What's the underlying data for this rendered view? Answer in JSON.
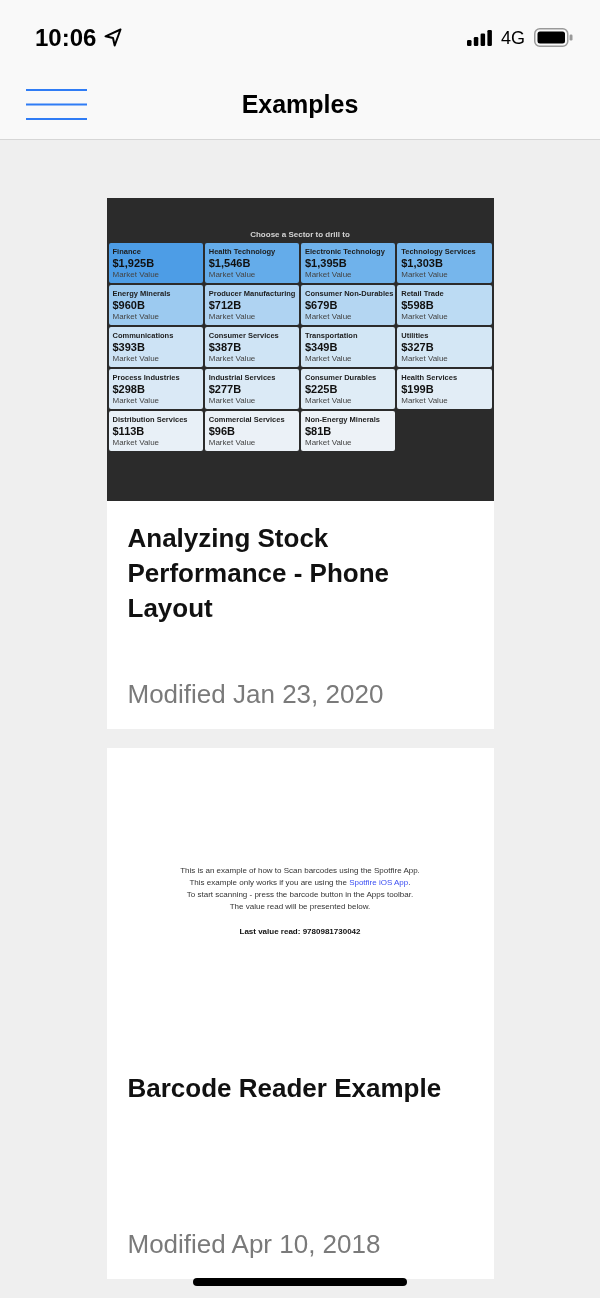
{
  "status_bar": {
    "time": "10:06",
    "network": "4G"
  },
  "nav_bar": {
    "title": "Examples"
  },
  "examples": [
    {
      "kind": "sector_dashboard",
      "preview": {
        "heading": "Choose a Sector to drill to",
        "tiles": [
          {
            "name": "Finance",
            "value": "$1,925B",
            "caption": "Market Value",
            "color": "#4d9de6"
          },
          {
            "name": "Health Technology",
            "value": "$1,546B",
            "caption": "Market Value",
            "color": "#64acea"
          },
          {
            "name": "Electronic Technology",
            "value": "$1,395B",
            "caption": "Market Value",
            "color": "#6fb2eb"
          },
          {
            "name": "Technology Services",
            "value": "$1,303B",
            "caption": "Market Value",
            "color": "#76b6ec"
          },
          {
            "name": "Energy Minerals",
            "value": "$960B",
            "caption": "Market Value",
            "color": "#9ccaf0"
          },
          {
            "name": "Producer Manufacturing",
            "value": "$712B",
            "caption": "Market Value",
            "color": "#afd3f2"
          },
          {
            "name": "Consumer Non-Durables",
            "value": "$679B",
            "caption": "Market Value",
            "color": "#b4d6f2"
          },
          {
            "name": "Retail Trade",
            "value": "$598B",
            "caption": "Market Value",
            "color": "#bcdbf3"
          },
          {
            "name": "Communications",
            "value": "$393B",
            "caption": "Market Value",
            "color": "#cde3f5"
          },
          {
            "name": "Consumer Services",
            "value": "$387B",
            "caption": "Market Value",
            "color": "#cfe4f5"
          },
          {
            "name": "Transportation",
            "value": "$349B",
            "caption": "Market Value",
            "color": "#d2e6f5"
          },
          {
            "name": "Utilities",
            "value": "$327B",
            "caption": "Market Value",
            "color": "#d4e7f5"
          },
          {
            "name": "Process Industries",
            "value": "$298B",
            "caption": "Market Value",
            "color": "#dae9f6"
          },
          {
            "name": "Industrial Services",
            "value": "$277B",
            "caption": "Market Value",
            "color": "#dbeaf6"
          },
          {
            "name": "Consumer Durables",
            "value": "$225B",
            "caption": "Market Value",
            "color": "#dfecf6"
          },
          {
            "name": "Health Services",
            "value": "$199B",
            "caption": "Market Value",
            "color": "#e2edf6"
          },
          {
            "name": "Distribution Services",
            "value": "$113B",
            "caption": "Market Value",
            "color": "#e8f0f7"
          },
          {
            "name": "Commercial Services",
            "value": "$96B",
            "caption": "Market Value",
            "color": "#ebf1f7"
          },
          {
            "name": "Non-Energy Minerals",
            "value": "$81B",
            "caption": "Market Value",
            "color": "#edf2f7"
          }
        ]
      },
      "title": "Analyzing Stock Performance - Phone Layout",
      "modified": "Modified Jan 23, 2020"
    },
    {
      "kind": "barcode_info",
      "preview": {
        "lines": [
          {
            "segments": [
              {
                "kind": "text",
                "text": "This is an example of how to Scan barcodes using the Spotfire App."
              }
            ]
          },
          {
            "segments": [
              {
                "kind": "text",
                "text": "This example only works if you are using the "
              },
              {
                "kind": "link",
                "text": "Spotfire iOS App"
              },
              {
                "kind": "text",
                "text": "."
              }
            ]
          },
          {
            "segments": [
              {
                "kind": "text",
                "text": "To start scanning - press the barcode button in the Apps toolbar."
              }
            ]
          },
          {
            "segments": [
              {
                "kind": "text",
                "text": "The value read will be presented below."
              }
            ]
          }
        ],
        "last_value": "Last value read: 9780981730042"
      },
      "title": "Barcode Reader Example",
      "modified": "Modified Apr 10, 2018"
    }
  ]
}
